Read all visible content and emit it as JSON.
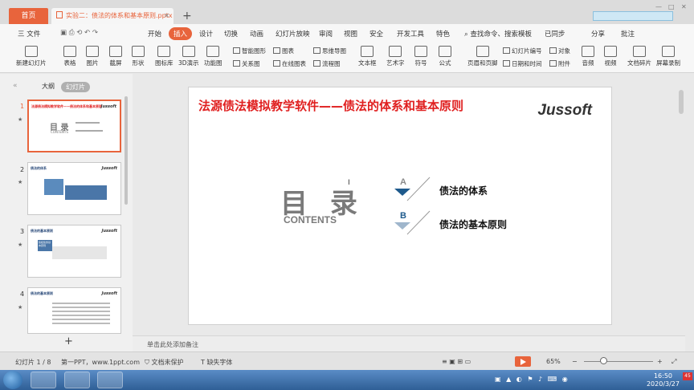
{
  "tabs": {
    "home": "首页",
    "doc": "实验二：债法的体系和基本原则.pptx",
    "new_tab": "+"
  },
  "menu": {
    "file": "三 文件",
    "items": [
      "开始",
      "插入",
      "设计",
      "切换",
      "动画",
      "幻灯片放映",
      "审阅",
      "视图",
      "安全",
      "开发工具",
      "特色"
    ],
    "active": "插入",
    "search": "查找命令、搜索模板",
    "sync": "已同步",
    "share": "分享",
    "comment": "批注"
  },
  "ribbon": {
    "new_slide": "新建幻灯片",
    "table": "表格",
    "picture": "图片",
    "screenshot": "截屏",
    "shape": "形状",
    "icon_lib": "图标库",
    "demo3d": "3D演示",
    "func_chart": "功能图",
    "smart_art": "智能图形",
    "chart": "图表",
    "relation": "关系图",
    "online_chart": "在线图表",
    "mind_map": "思维导图",
    "flow_chart": "流程图",
    "text_box": "文本框",
    "art_text": "艺术字",
    "symbol": "符号",
    "formula": "公式",
    "header_footer": "页眉和页脚",
    "slide_number": "幻灯片编号",
    "date_time": "日期和时间",
    "object": "对象",
    "attachment": "附件",
    "audio": "音频",
    "video": "视频",
    "doc_fragment": "文档碎片",
    "screen_record": "屏幕录制"
  },
  "panel": {
    "outline": "大纲",
    "slides": "幻灯片",
    "add": "+"
  },
  "thumbnails": [
    {
      "num": "1",
      "star": "★"
    },
    {
      "num": "2",
      "star": "★"
    },
    {
      "num": "3",
      "star": "★"
    },
    {
      "num": "4",
      "star": "★"
    }
  ],
  "thumb_text": {
    "t1_head": "法源债法模拟教学软件——债法的体系和基本原则",
    "brand": "Jussoft",
    "t1_title": "目 录",
    "t1_sub": "CONTENTS",
    "t2_head": "债法的体系",
    "t3_head": "债法的基本原则",
    "t3_box": "债权债务基本原则",
    "t4_head": "债法的基本原则"
  },
  "slide": {
    "title": "法源债法模拟教学软件——债法的体系和基本原则",
    "brand": "Jussoft",
    "toc_title": "目 录",
    "toc_sub": "CONTENTS",
    "items": [
      {
        "marker": "A",
        "label": "债法的体系"
      },
      {
        "marker": "B",
        "label": "债法的基本原则"
      }
    ]
  },
  "notes": {
    "placeholder": "单击此处添加备注"
  },
  "status": {
    "slide_count": "幻灯片 1 / 8",
    "theme": "第一PPT，www.1ppt.com",
    "protect": "文档未保护",
    "missing_font": "缺失字体",
    "zoom": "65%"
  },
  "taskbar": {
    "time": "16:50",
    "date": "2020/3/27",
    "notif": "45"
  },
  "colors": {
    "accent": "#e8643c",
    "title_red": "#e02020",
    "marker_blue": "#1e5a8c"
  }
}
